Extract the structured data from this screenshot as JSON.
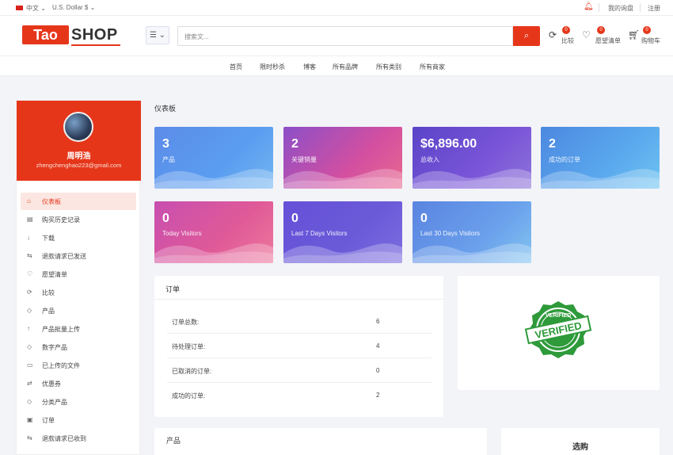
{
  "topbar": {
    "language": "中文 ⌄",
    "currency": "U.S. Dollar $ ⌄",
    "my_rfq": "我的询盘",
    "register": "注册"
  },
  "header": {
    "logo_tao": "Tao",
    "logo_shop": "SHOP",
    "search_placeholder": "搜索文...",
    "icons": [
      {
        "name": "compare",
        "label": "比较",
        "badge": "0"
      },
      {
        "name": "wishlist",
        "label": "愿望清单",
        "badge": "0"
      },
      {
        "name": "cart",
        "label": "购物车",
        "badge": "0"
      }
    ]
  },
  "nav": [
    "首页",
    "限时秒杀",
    "博客",
    "所有品牌",
    "所有类别",
    "所有商家"
  ],
  "profile": {
    "name": "周明浩",
    "email": "zhengchenghao223@gmail.com"
  },
  "sidebar": {
    "items": [
      {
        "icon": "⌂",
        "label": "仪表板",
        "active": true
      },
      {
        "icon": "▤",
        "label": "购买历史记录"
      },
      {
        "icon": "↓",
        "label": "下载"
      },
      {
        "icon": "⇆",
        "label": "退款请求已发送"
      },
      {
        "icon": "♡",
        "label": "愿望清单"
      },
      {
        "icon": "⟳",
        "label": "比较"
      },
      {
        "icon": "◇",
        "label": "产品"
      },
      {
        "icon": "↑",
        "label": "产品批量上传"
      },
      {
        "icon": "◇",
        "label": "数字产品"
      },
      {
        "icon": "▭",
        "label": "已上传的文件"
      },
      {
        "icon": "⇄",
        "label": "优惠券"
      },
      {
        "icon": "◇",
        "label": "分类产品"
      },
      {
        "icon": "▣",
        "label": "订单"
      },
      {
        "icon": "⇆",
        "label": "退款请求已收到"
      }
    ]
  },
  "dashboard_title": "仪表板",
  "cards": [
    {
      "value": "3",
      "label": "产品"
    },
    {
      "value": "2",
      "label": "关键销量"
    },
    {
      "value": "$6,896.00",
      "label": "总收入"
    },
    {
      "value": "2",
      "label": "成功的订单"
    },
    {
      "value": "0",
      "label": "Today Visitors"
    },
    {
      "value": "0",
      "label": "Last 7 Days Visitors"
    },
    {
      "value": "0",
      "label": "Last 30 Days Visitors"
    }
  ],
  "orders": {
    "title": "订单",
    "rows": [
      {
        "label": "订单总数:",
        "value": "6"
      },
      {
        "label": "待处理订单:",
        "value": "4"
      },
      {
        "label": "已取消的订单:",
        "value": "0"
      },
      {
        "label": "成功的订单:",
        "value": "2"
      }
    ]
  },
  "verified_seal": {
    "text_top": "VERIFIED",
    "text_main": "VERIFIED",
    "color": "#2e9a3a"
  },
  "products_panel_title": "产品",
  "select_panel_title": "选购"
}
